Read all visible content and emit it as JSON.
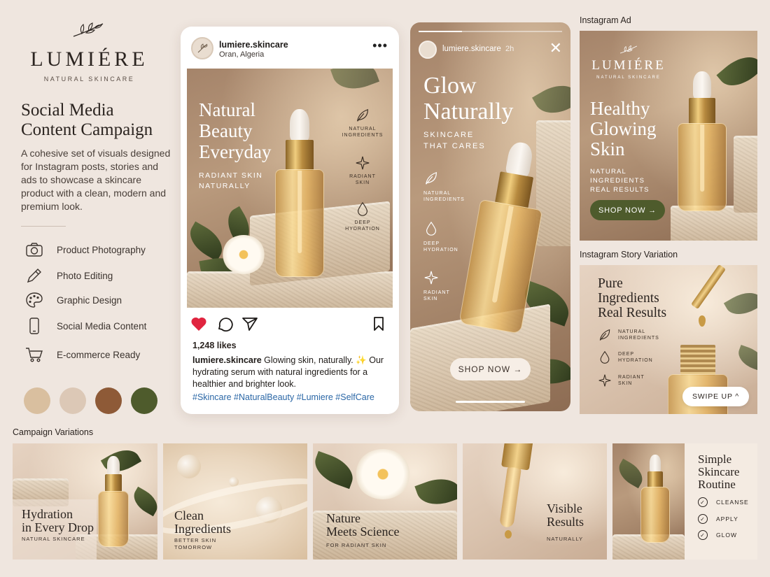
{
  "brand": {
    "name": "LUMIÉRE",
    "tagline": "NATURAL SKINCARE",
    "icon": "leaf-branch-icon"
  },
  "campaign": {
    "title_line1": "Social Media",
    "title_line2": "Content Campaign",
    "description": "A cohesive set of visuals designed for Instagram posts, stories and ads to showcase a skincare product with a clean, modern and premium look."
  },
  "services": [
    {
      "label": "Product Photography",
      "icon": "camera-icon"
    },
    {
      "label": "Photo Editing",
      "icon": "pencil-icon"
    },
    {
      "label": "Graphic Design",
      "icon": "palette-icon"
    },
    {
      "label": "Social Media Content",
      "icon": "smartphone-icon"
    },
    {
      "label": "E-commerce Ready",
      "icon": "shopping-cart-icon"
    }
  ],
  "palette": [
    "#d9bf9f",
    "#dcc8b6",
    "#8e5a37",
    "#4e5b2c"
  ],
  "post": {
    "handle": "lumiere.skincare",
    "location": "Oran, Algeria",
    "headline_line1": "Natural",
    "headline_line2": "Beauty",
    "headline_line3": "Everyday",
    "sub_line1": "RADIANT SKIN",
    "sub_line2": "NATURALLY",
    "features": [
      {
        "line1": "NATURAL",
        "line2": "INGREDIENTS",
        "icon": "leaf-icon"
      },
      {
        "line1": "RADIANT",
        "line2": "SKIN",
        "icon": "sparkle-icon"
      },
      {
        "line1": "DEEP",
        "line2": "HYDRATION",
        "icon": "droplet-icon"
      }
    ],
    "likes": "1,248 likes",
    "caption_handle": "lumiere.skincare",
    "caption_text": " Glowing skin, naturally. ✨ Our hydrating serum with natural ingredients for a healthier and brighter look.",
    "hashtags": "#Skincare #NaturalBeauty #Lumiere #SelfCare"
  },
  "story": {
    "handle": "lumiere.skincare",
    "time": "2h",
    "headline_line1": "Glow",
    "headline_line2": "Naturally",
    "sub_line1": "SKINCARE",
    "sub_line2": "THAT CARES",
    "features": [
      {
        "line1": "NATURAL",
        "line2": "INGREDIENTS",
        "icon": "leaf-icon"
      },
      {
        "line1": "DEEP",
        "line2": "HYDRATION",
        "icon": "droplet-icon"
      },
      {
        "line1": "RADIANT",
        "line2": "SKIN",
        "icon": "sparkle-icon"
      }
    ],
    "cta": "SHOP NOW →"
  },
  "ad": {
    "section_label": "Instagram Ad",
    "logo_name": "LUMIÉRE",
    "logo_tagline": "NATURAL SKINCARE",
    "headline_line1": "Healthy",
    "headline_line2": "Glowing",
    "headline_line3": "Skin",
    "sub_line1": "NATURAL INGREDIENTS",
    "sub_line2": "REAL RESULTS",
    "cta": "SHOP NOW →"
  },
  "story_variation": {
    "section_label": "Instagram Story Variation",
    "headline_line1": "Pure",
    "headline_line2": "Ingredients",
    "headline_line3": "Real Results",
    "features": [
      {
        "line1": "NATURAL",
        "line2": "INGREDIENTS",
        "icon": "leaf-icon"
      },
      {
        "line1": "DEEP",
        "line2": "HYDRATION",
        "icon": "droplet-icon"
      },
      {
        "line1": "RADIANT",
        "line2": "SKIN",
        "icon": "sparkle-icon"
      }
    ],
    "cta": "SWIPE UP ^"
  },
  "variations": {
    "section_label": "Campaign Variations",
    "items": [
      {
        "title_line1": "Hydration",
        "title_line2": "in Every Drop",
        "sub_line1": "NATURAL SKINCARE",
        "sub_line2": ""
      },
      {
        "title_line1": "Clean",
        "title_line2": "Ingredients",
        "sub_line1": "BETTER SKIN",
        "sub_line2": "TOMORROW"
      },
      {
        "title_line1": "Nature",
        "title_line2": "Meets Science",
        "sub_line1": "FOR RADIANT SKIN",
        "sub_line2": ""
      },
      {
        "title_line1": "Visible",
        "title_line2": "Results",
        "sub_line1": "NATURALLY",
        "sub_line2": ""
      },
      {
        "title_line1": "Simple",
        "title_line2": "Skincare",
        "title_line3": "Routine",
        "checklist": [
          "CLEANSE",
          "APPLY",
          "GLOW"
        ]
      }
    ]
  }
}
